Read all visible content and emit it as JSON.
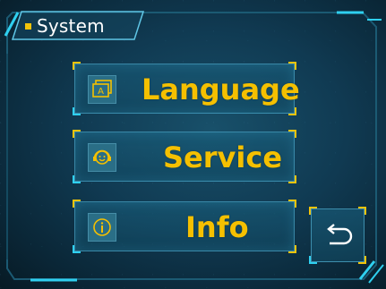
{
  "screen": {
    "title": "System"
  },
  "menu": {
    "items": [
      {
        "label": "Language",
        "icon": "language-icon"
      },
      {
        "label": "Service",
        "icon": "customer-service-icon"
      },
      {
        "label": "Info",
        "icon": "info-icon"
      }
    ]
  },
  "back": {
    "icon": "back-arrow-icon"
  },
  "colors": {
    "accent_yellow": "#f5c000",
    "accent_cyan": "#2fd0f0",
    "background": "#103a52"
  }
}
